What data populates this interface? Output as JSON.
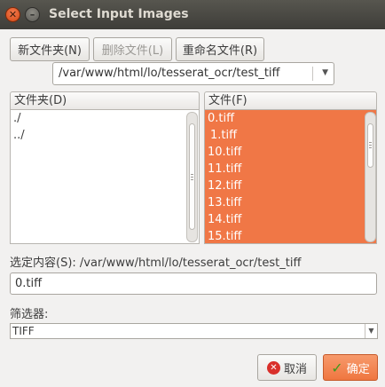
{
  "window": {
    "title": "Select Input Images"
  },
  "toolbar": {
    "new_folder": "新文件夹(N)",
    "delete_file": "删除文件(L)",
    "rename_file": "重命名文件(R)"
  },
  "path_combo": {
    "value": "/var/www/html/lo/tesserat_ocr/test_tiff"
  },
  "folders": {
    "header": "文件夹(D)",
    "items": [
      "./",
      "../"
    ]
  },
  "files": {
    "header": "文件(F)",
    "items": [
      "0.tiff",
      "1.tiff",
      "10.tiff",
      "11.tiff",
      "12.tiff",
      "13.tiff",
      "14.tiff",
      "15.tiff"
    ]
  },
  "selection": {
    "label": "选定内容(S):",
    "path": "/var/www/html/lo/tesserat_ocr/test_tiff",
    "value": "0.tiff"
  },
  "filter": {
    "label": "筛选器:",
    "value": "TIFF"
  },
  "buttons": {
    "cancel": "取消",
    "ok": "确定"
  },
  "icons": {
    "close": "close-icon",
    "minimize": "minimize-icon",
    "cancel": "cancel-icon",
    "ok": "checkmark-icon"
  },
  "colors": {
    "selection": "#f07746",
    "titlebar": "#3e3d39"
  }
}
